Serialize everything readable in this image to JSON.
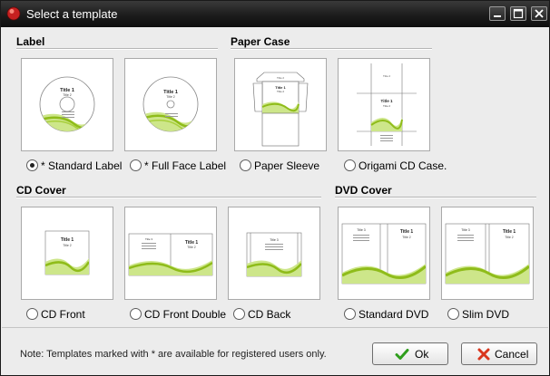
{
  "window": {
    "title": "Select a template"
  },
  "sections": {
    "label": "Label",
    "paper_case": "Paper Case",
    "cd_cover": "CD Cover",
    "dvd_cover": "DVD Cover"
  },
  "thumb_text": {
    "title1": "Title 1",
    "title2": "Title 2",
    "title3": "Title 3"
  },
  "templates": {
    "standard_label": {
      "label": "* Standard Label",
      "selected": true
    },
    "full_face_label": {
      "label": "* Full Face Label",
      "selected": false
    },
    "paper_sleeve": {
      "label": "Paper Sleeve",
      "selected": false
    },
    "origami_cd_case": {
      "label": "Origami CD Case.",
      "selected": false
    },
    "cd_front": {
      "label": "CD Front",
      "selected": false
    },
    "cd_front_double": {
      "label": "CD Front Double",
      "selected": false
    },
    "cd_back": {
      "label": "CD Back",
      "selected": false
    },
    "standard_dvd": {
      "label": "Standard DVD",
      "selected": false
    },
    "slim_dvd": {
      "label": "Slim DVD",
      "selected": false
    }
  },
  "note": "Note: Templates marked with * are available for registered users only.",
  "buttons": {
    "ok": "Ok",
    "cancel": "Cancel"
  },
  "colors": {
    "accent_green": "#8fbc1a",
    "titlebar": "#1c1c1c",
    "background": "#ececec"
  },
  "icons": {
    "app": "app-ball-icon",
    "minimize": "minimize-icon",
    "maximize": "maximize-icon",
    "close": "close-icon",
    "ok": "green-check-icon",
    "cancel": "red-x-icon"
  }
}
